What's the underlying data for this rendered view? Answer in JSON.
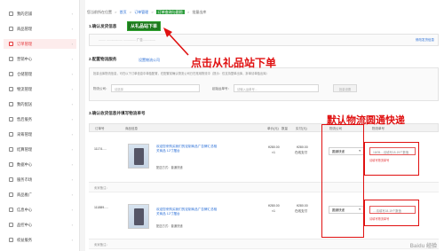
{
  "sidebar": {
    "items": [
      {
        "label": "我的店铺",
        "icon": "store-icon",
        "active": false
      },
      {
        "label": "商品管理",
        "icon": "product-icon",
        "active": false
      },
      {
        "label": "订单管理",
        "icon": "order-icon",
        "active": true
      },
      {
        "label": "营销中心",
        "icon": "marketing-icon",
        "active": false
      },
      {
        "label": "仓储管理",
        "icon": "warehouse-icon",
        "active": false
      },
      {
        "label": "物流管理",
        "icon": "logistics-icon",
        "active": false
      },
      {
        "label": "我的配送",
        "icon": "delivery-icon",
        "active": false
      },
      {
        "label": "售后服务",
        "icon": "aftersale-icon",
        "active": false
      },
      {
        "label": "采筹管理",
        "icon": "purchase-icon",
        "active": false
      },
      {
        "label": "结算管理",
        "icon": "settlement-icon",
        "active": false
      },
      {
        "label": "数据中心",
        "icon": "data-icon",
        "active": false
      },
      {
        "label": "服务市场",
        "icon": "service-icon",
        "active": false
      },
      {
        "label": "商品推广",
        "icon": "promotion-icon",
        "active": false
      },
      {
        "label": "信息中心",
        "icon": "info-icon",
        "active": false
      },
      {
        "label": "品控中心",
        "icon": "quality-icon",
        "active": false
      },
      {
        "label": "权益服务",
        "icon": "rights-icon",
        "active": false
      }
    ]
  },
  "breadcrumb": {
    "prefix": "您当前所在位置",
    "items": [
      "首页",
      "订单管理",
      "订单查询与跟踪",
      "批量出库"
    ],
    "highlight": "订单查询与跟踪"
  },
  "section1": {
    "title": "1.确认发货信息",
    "note": "从礼品站下单",
    "addr_text": "........   ...................   ..............   广告...............",
    "addr_link": "修改发货信息"
  },
  "section2": {
    "title": "2.配置物流服务",
    "config_link": "设置物流公司",
    "note": "批量出库物流信息，可在以下订单信息中单独配置，在配置前确认物流公司已在常用物流中（提示：仅支持整单出库，拆单请单独出库）",
    "carrier_label": "物流公司：",
    "carrier_placeholder": "请选择",
    "tracking_label": "起始运单号：",
    "tracking_placeholder": "请输入运单号...",
    "button": "批量设置"
  },
  "section3": {
    "title": "3.确认收货信息并填写物流单号",
    "headers": [
      "订单号",
      "商品信息",
      "单价(元)",
      "数量",
      "实付(元)",
      "物流公司",
      "物流单号"
    ],
    "orders": [
      {
        "order_no": "11174.....",
        "product": "欢迎您来购买我们的定制商品广告牌汇总相关商品 12寸摆台",
        "delivery": "配送方式：普通快递",
        "price": "¥280.00",
        "qty": "×1",
        "paid": "¥280.00",
        "pay_type": "在线支付",
        "carrier": "圆通快递",
        "tracking": "18/05....请填写18-19个数值",
        "error": "请填写物流单号"
      },
      {
        "order_no": "111889.....",
        "product": "欢迎您来购买我们的定制商品广告牌汇总相关商品 12寸摆台",
        "delivery": "配送方式：普通快递",
        "price": "¥280.00",
        "qty": "×1",
        "paid": "¥280.00",
        "pay_type": "在线支付",
        "carrier": "圆通快递",
        "tracking": "....请填写18-19个数值",
        "error": "请填写物流单号"
      }
    ],
    "remark1": "卖家备注：",
    "remark2": "卖家备注："
  },
  "annotations": {
    "click_hint": "点击从礼品站下单",
    "default_logistics": "默认物流圆通快递"
  },
  "watermark": "Baidu 经验",
  "colors": {
    "accent": "#e4393c",
    "annotation": "#e01010",
    "label_green": "#1f7a1f",
    "link": "#2b6fd6"
  }
}
